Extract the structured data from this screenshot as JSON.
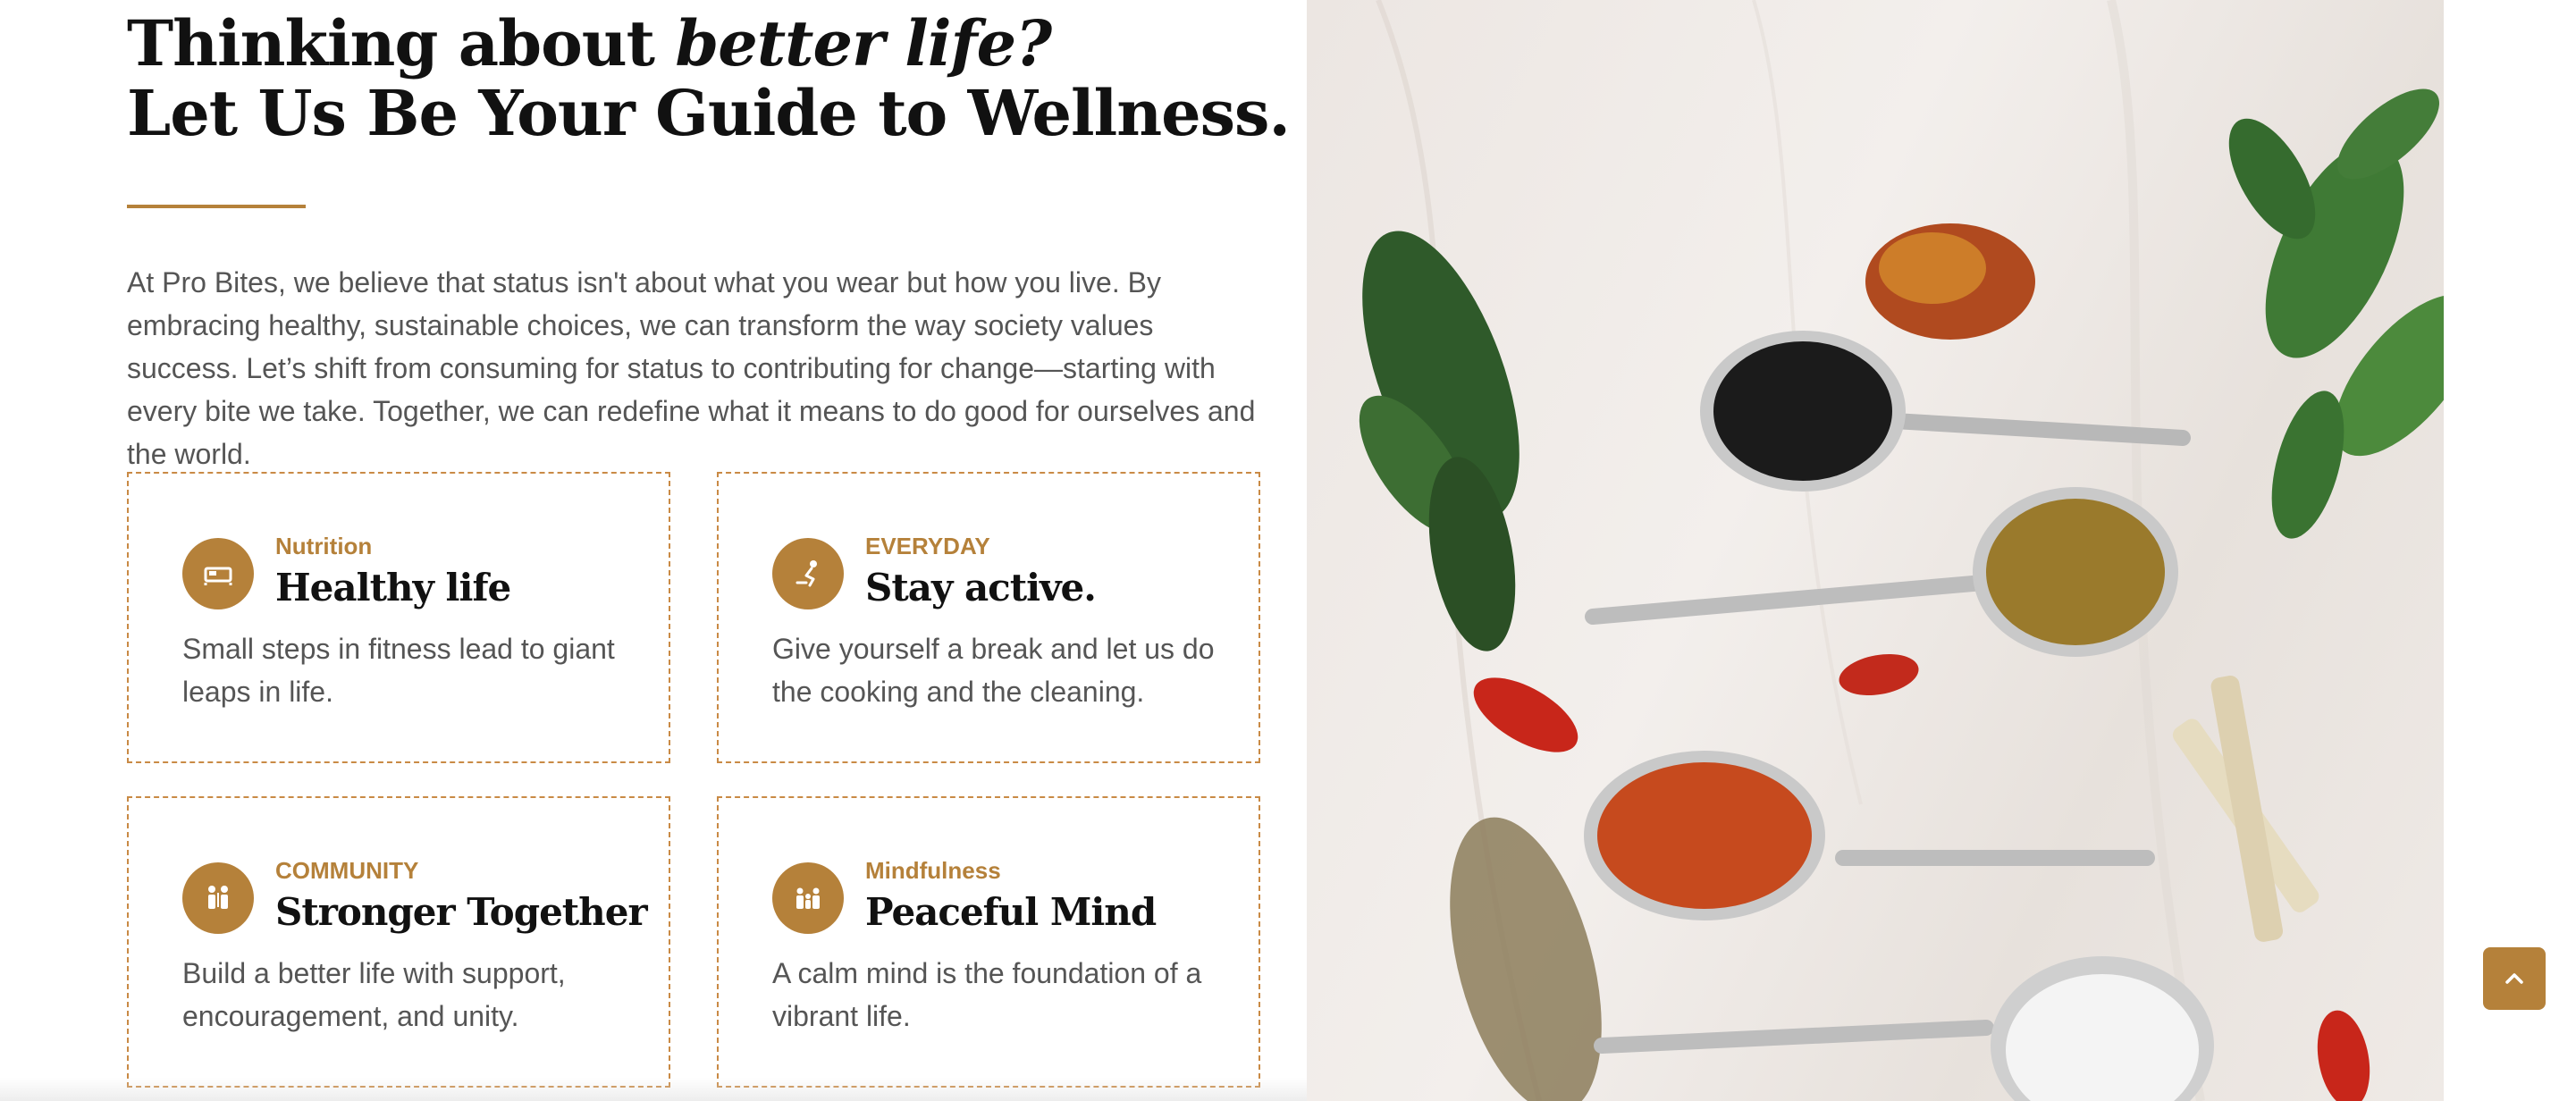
{
  "heading": {
    "line1_plain": "Thinking about ",
    "line1_italic": "better life?",
    "line2": "Let Us Be Your Guide to Wellness."
  },
  "intro": "At Pro Bites, we believe that status isn't about what you wear but how you live. By embracing healthy, sustainable choices, we can transform the way society values success. Let’s shift from consuming for status to contributing for change—starting with every bite we take. Together, we can redefine what it means to do good for ourselves and the world.",
  "cards": [
    {
      "kicker": "Nutrition",
      "title": "Healthy life",
      "desc": "Small steps in fitness lead to giant leaps in life.",
      "icon": "bed-icon"
    },
    {
      "kicker": "EVERYDAY",
      "title": "Stay active.",
      "desc": "Give yourself a break and let us do the cooking and the cleaning.",
      "icon": "exercise-icon"
    },
    {
      "kicker": "COMMUNITY",
      "title": "Stronger Together",
      "desc": "Build a better life with support, encouragement, and unity.",
      "icon": "people-icon"
    },
    {
      "kicker": "Mindfulness",
      "title": "Peaceful Mind",
      "desc": "A calm mind is the foundation of a vibrant life.",
      "icon": "family-icon"
    }
  ],
  "hero_image": {
    "icon": "spices-photo"
  },
  "scroll_top": {
    "icon": "chevron-up-icon"
  },
  "colors": {
    "accent": "#b5813a",
    "text": "#555555",
    "heading": "#111111"
  }
}
